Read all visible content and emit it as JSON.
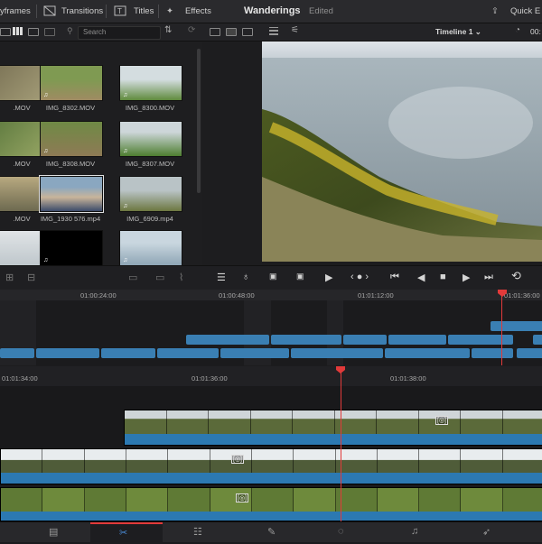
{
  "topbar": {
    "keyframes_label": "yframes",
    "transitions_label": "Transitions",
    "titles_label": "Titles",
    "effects_label": "Effects",
    "project_title": "Wanderings",
    "project_status": "Edited",
    "quick_export_label": "Quick E"
  },
  "toolbar2": {
    "search_placeholder": "Search",
    "timeline_name": "Timeline 1 ⌄",
    "timecode_partial": "00:"
  },
  "media_pool": {
    "clips": [
      {
        "label": ".MOV",
        "audio": false
      },
      {
        "label": "IMG_8302.MOV",
        "audio": true
      },
      {
        "label": "IMG_8300.MOV",
        "audio": true
      },
      {
        "label": ".MOV",
        "audio": false
      },
      {
        "label": "IMG_8308.MOV",
        "audio": true
      },
      {
        "label": "IMG_8307.MOV",
        "audio": true
      },
      {
        "label": ".MOV",
        "audio": false
      },
      {
        "label": "IMG_1930 576.mp4",
        "audio": false
      },
      {
        "label": "IMG_6909.mp4",
        "audio": true
      },
      {
        "label": "",
        "audio": false
      },
      {
        "label": "",
        "audio": true
      },
      {
        "label": "",
        "audio": true
      }
    ]
  },
  "upper_timeline": {
    "timecodes": [
      "01:00:24:00",
      "01:00:48:00",
      "01:01:12:00",
      "01:01:36:00"
    ]
  },
  "lower_timeline": {
    "timecodes": [
      "01:01:34:00",
      "01:01:36:00",
      "01:01:38:00"
    ],
    "badge": "[◎]"
  },
  "pagebar": {
    "pages": [
      "media-page",
      "cut-page",
      "edit-page",
      "fusion-page",
      "color-page",
      "fairlight-page",
      "deliver-page"
    ]
  }
}
